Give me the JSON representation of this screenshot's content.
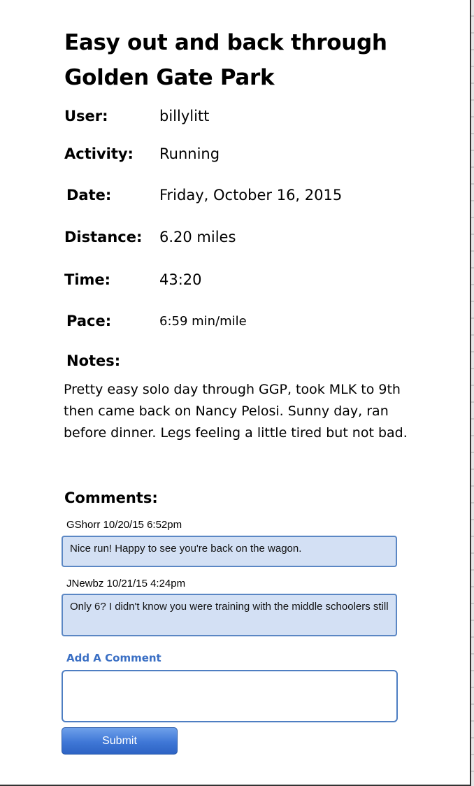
{
  "workout": {
    "title": "Easy out and back through Golden Gate Park",
    "fields": [
      {
        "label": "User:",
        "value": "billylitt"
      },
      {
        "label": "Activity:",
        "value": "Running"
      },
      {
        "label": "Date:",
        "value": "Friday, October 16, 2015"
      },
      {
        "label": "Distance:",
        "value": "6.20 miles"
      },
      {
        "label": "Time:",
        "value": "43:20"
      },
      {
        "label": "Pace:",
        "value": "6:59 min/mile"
      }
    ],
    "notes_label": "Notes:",
    "notes": "Pretty easy solo day through GGP, took MLK to 9th then came back on Nancy Pelosi. Sunny day, ran before dinner. Legs feeling a little tired but not bad."
  },
  "comments": {
    "label": "Comments:",
    "items": [
      {
        "meta": "GShorr 10/20/15 6:52pm",
        "text": "Nice run! Happy to see you're back on the wagon."
      },
      {
        "meta": "JNewbz 10/21/15 4:24pm",
        "text": "Only 6? I didn't know you were training with the middle schoolers still"
      }
    ]
  },
  "add_comment": {
    "label": "Add A Comment",
    "value": "",
    "submit_label": "Submit"
  }
}
